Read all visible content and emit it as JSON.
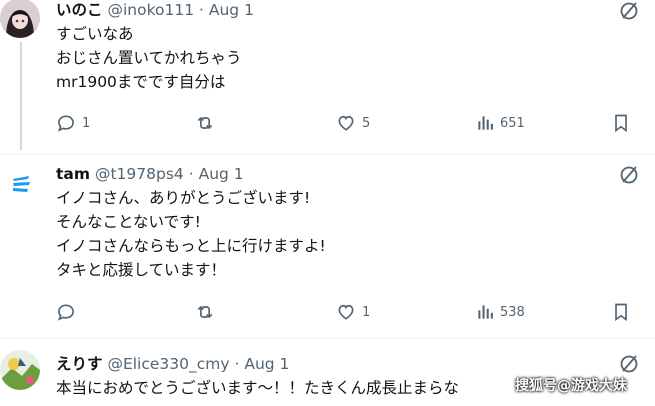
{
  "posts": [
    {
      "display_name": "いのこ",
      "handle": "@inoko111",
      "date_sep": "·",
      "date": "Aug 1",
      "lines": [
        "すごいなあ",
        "おじさん置いてかれちゃう",
        "mr1900までです自分は"
      ],
      "replies": "1",
      "reposts": "",
      "likes": "5",
      "views": "651"
    },
    {
      "display_name": "tam",
      "handle": "@t1978ps4",
      "date_sep": "·",
      "date": "Aug 1",
      "lines": [
        "イノコさん、ありがとうございます!",
        "そんなことないです!",
        "イノコさんならもっと上に行けますよ!",
        "タキと応援しています！"
      ],
      "replies": "",
      "reposts": "",
      "likes": "1",
      "views": "538"
    },
    {
      "display_name": "えりす",
      "handle": "@Elice330_cmy",
      "date_sep": "·",
      "date": "Aug 1",
      "lines": [
        "本当におめでとうございます〜！！たきくん成長止まらな"
      ]
    }
  ],
  "watermark": "搜狐号@游戏大妹",
  "icons": {
    "reply": "reply-icon",
    "repost": "repost-icon",
    "like": "heart-icon",
    "views": "views-icon",
    "bookmark": "bookmark-icon",
    "not_interested": "not-interested-icon"
  }
}
